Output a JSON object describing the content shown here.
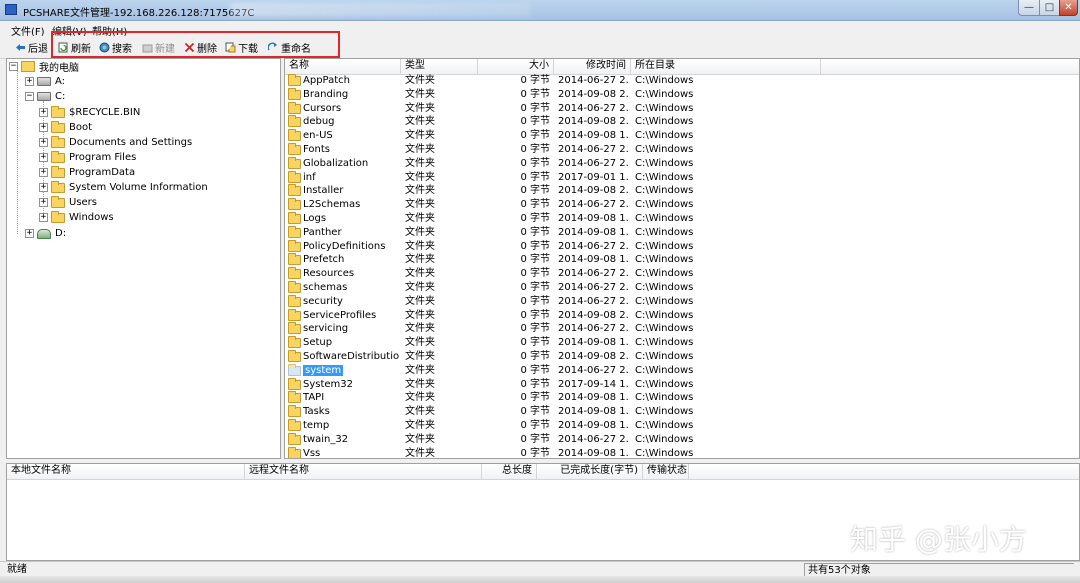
{
  "window": {
    "title": "PCSHARE文件管理-192.168.226.128:7175627C",
    "min_label": "—",
    "max_label": "□",
    "close_label": "✕"
  },
  "menu": [
    {
      "label": "文件(F)"
    },
    {
      "label": "编辑(V)"
    },
    {
      "label": "帮助(H)"
    }
  ],
  "toolbar": {
    "back": "后退",
    "refresh": "刷新",
    "search": "搜索",
    "new": "新建",
    "delete": "删除",
    "download": "下载",
    "rename": "重命名"
  },
  "tree": {
    "root": "我的电脑",
    "drive_a": "A:",
    "drive_c": "C:",
    "drive_d": "D:",
    "children_c": [
      {
        "label": "$RECYCLE.BIN"
      },
      {
        "label": "Boot"
      },
      {
        "label": "Documents and Settings"
      },
      {
        "label": "Program Files"
      },
      {
        "label": "ProgramData"
      },
      {
        "label": "System Volume Information"
      },
      {
        "label": "Users"
      },
      {
        "label": "Windows"
      }
    ]
  },
  "list": {
    "columns": {
      "name": "名称",
      "type": "类型",
      "size": "大小",
      "modified": "修改时间",
      "dir": "所在目录"
    },
    "rows": [
      {
        "name": "AppPatch",
        "type": "文件夹",
        "size": "0 字节",
        "modified": "2014-06-27 2...",
        "dir": "C:\\Windows"
      },
      {
        "name": "Branding",
        "type": "文件夹",
        "size": "0 字节",
        "modified": "2014-09-08 2...",
        "dir": "C:\\Windows"
      },
      {
        "name": "Cursors",
        "type": "文件夹",
        "size": "0 字节",
        "modified": "2014-06-27 2...",
        "dir": "C:\\Windows"
      },
      {
        "name": "debug",
        "type": "文件夹",
        "size": "0 字节",
        "modified": "2014-09-08 2...",
        "dir": "C:\\Windows"
      },
      {
        "name": "en-US",
        "type": "文件夹",
        "size": "0 字节",
        "modified": "2014-09-08 1...",
        "dir": "C:\\Windows"
      },
      {
        "name": "Fonts",
        "type": "文件夹",
        "size": "0 字节",
        "modified": "2014-06-27 2...",
        "dir": "C:\\Windows"
      },
      {
        "name": "Globalization",
        "type": "文件夹",
        "size": "0 字节",
        "modified": "2014-06-27 2...",
        "dir": "C:\\Windows"
      },
      {
        "name": "inf",
        "type": "文件夹",
        "size": "0 字节",
        "modified": "2017-09-01 1...",
        "dir": "C:\\Windows"
      },
      {
        "name": "Installer",
        "type": "文件夹",
        "size": "0 字节",
        "modified": "2014-09-08 2...",
        "dir": "C:\\Windows"
      },
      {
        "name": "L2Schemas",
        "type": "文件夹",
        "size": "0 字节",
        "modified": "2014-06-27 2...",
        "dir": "C:\\Windows"
      },
      {
        "name": "Logs",
        "type": "文件夹",
        "size": "0 字节",
        "modified": "2014-09-08 1...",
        "dir": "C:\\Windows"
      },
      {
        "name": "Panther",
        "type": "文件夹",
        "size": "0 字节",
        "modified": "2014-09-08 1...",
        "dir": "C:\\Windows"
      },
      {
        "name": "PolicyDefinitions",
        "type": "文件夹",
        "size": "0 字节",
        "modified": "2014-06-27 2...",
        "dir": "C:\\Windows"
      },
      {
        "name": "Prefetch",
        "type": "文件夹",
        "size": "0 字节",
        "modified": "2014-09-08 1...",
        "dir": "C:\\Windows"
      },
      {
        "name": "Resources",
        "type": "文件夹",
        "size": "0 字节",
        "modified": "2014-06-27 2...",
        "dir": "C:\\Windows"
      },
      {
        "name": "schemas",
        "type": "文件夹",
        "size": "0 字节",
        "modified": "2014-06-27 2...",
        "dir": "C:\\Windows"
      },
      {
        "name": "security",
        "type": "文件夹",
        "size": "0 字节",
        "modified": "2014-06-27 2...",
        "dir": "C:\\Windows"
      },
      {
        "name": "ServiceProfiles",
        "type": "文件夹",
        "size": "0 字节",
        "modified": "2014-09-08 2...",
        "dir": "C:\\Windows"
      },
      {
        "name": "servicing",
        "type": "文件夹",
        "size": "0 字节",
        "modified": "2014-06-27 2...",
        "dir": "C:\\Windows"
      },
      {
        "name": "Setup",
        "type": "文件夹",
        "size": "0 字节",
        "modified": "2014-09-08 1...",
        "dir": "C:\\Windows"
      },
      {
        "name": "SoftwareDistribution",
        "type": "文件夹",
        "size": "0 字节",
        "modified": "2014-09-08 2...",
        "dir": "C:\\Windows"
      },
      {
        "name": "system",
        "type": "文件夹",
        "size": "0 字节",
        "modified": "2014-06-27 2...",
        "dir": "C:\\Windows",
        "selected": true
      },
      {
        "name": "System32",
        "type": "文件夹",
        "size": "0 字节",
        "modified": "2017-09-14 1...",
        "dir": "C:\\Windows"
      },
      {
        "name": "TAPI",
        "type": "文件夹",
        "size": "0 字节",
        "modified": "2014-09-08 1...",
        "dir": "C:\\Windows"
      },
      {
        "name": "Tasks",
        "type": "文件夹",
        "size": "0 字节",
        "modified": "2014-09-08 1...",
        "dir": "C:\\Windows"
      },
      {
        "name": "temp",
        "type": "文件夹",
        "size": "0 字节",
        "modified": "2014-09-08 1...",
        "dir": "C:\\Windows"
      },
      {
        "name": "twain_32",
        "type": "文件夹",
        "size": "0 字节",
        "modified": "2014-06-27 2...",
        "dir": "C:\\Windows"
      },
      {
        "name": "Vss",
        "type": "文件夹",
        "size": "0 字节",
        "modified": "2014-09-08 1...",
        "dir": "C:\\Windows"
      }
    ]
  },
  "transfer": {
    "columns": {
      "local": "本地文件名称",
      "remote": "远程文件名称",
      "total": "总长度",
      "done": "已完成长度(字节)",
      "state": "传输状态"
    }
  },
  "status": {
    "left": "就绪",
    "right": "共有53个对象"
  },
  "watermark": "知乎 @张小方",
  "colors": {
    "highlight_box": "#e0262b",
    "selection": "#3399ff",
    "folder": "#f8d563"
  }
}
